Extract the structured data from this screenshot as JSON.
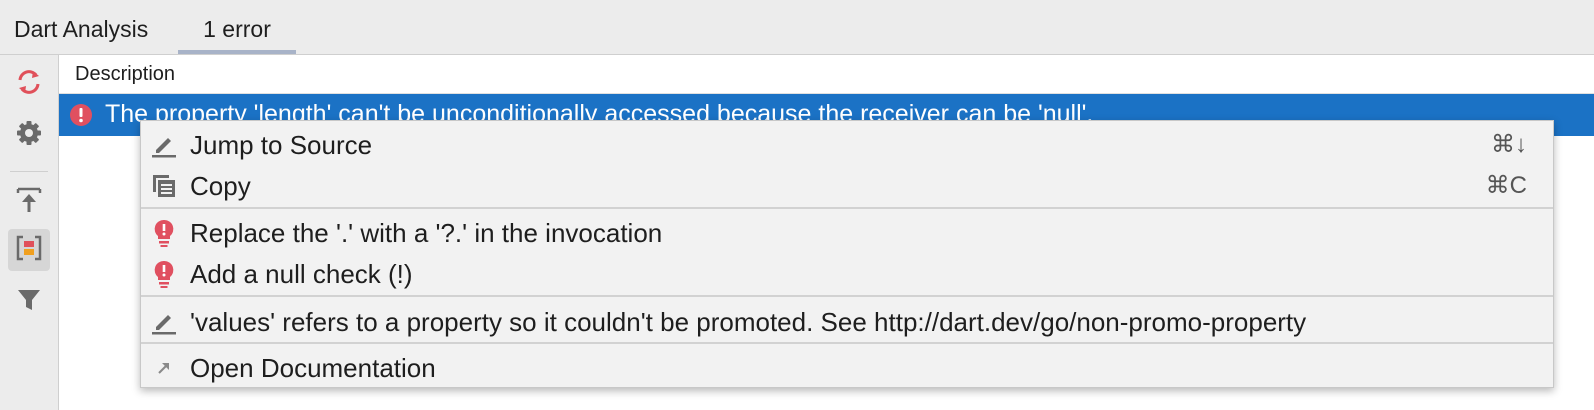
{
  "tabs": {
    "panel_title": "Dart Analysis",
    "errors_tab": "1 error"
  },
  "toolbar": {
    "icons": [
      "refresh-icon",
      "settings-gear-icon",
      "autoscroll-to-source-icon",
      "group-by-severity-icon",
      "filter-icon"
    ]
  },
  "table": {
    "column_header": "Description",
    "selected_row": {
      "icon": "error-icon",
      "message": "The property 'length' can't be unconditionally accessed because the receiver can be 'null'."
    }
  },
  "context_menu": {
    "jump_to_source": {
      "label": "Jump to Source",
      "shortcut": "⌘↓",
      "icon": "pencil-icon"
    },
    "copy": {
      "label": "Copy",
      "shortcut": "⌘C",
      "icon": "copy-icon"
    },
    "fix_replace": {
      "label": "Replace the '.' with a '?.' in the invocation",
      "icon": "error-bulb-icon"
    },
    "fix_null_check": {
      "label": "Add a null check (!)",
      "icon": "error-bulb-icon"
    },
    "context_message": {
      "label": "'values' refers to a property so it couldn't be promoted.  See http://dart.dev/go/non-promo-property",
      "icon": "pencil-icon"
    },
    "open_docs": {
      "label": "Open Documentation",
      "icon": "external-arrow-icon"
    }
  },
  "colors": {
    "selection": "#1b72c5",
    "error_red": "#e05060",
    "refresh_red": "#e0505a",
    "menu_bg": "#f2f2f2"
  }
}
